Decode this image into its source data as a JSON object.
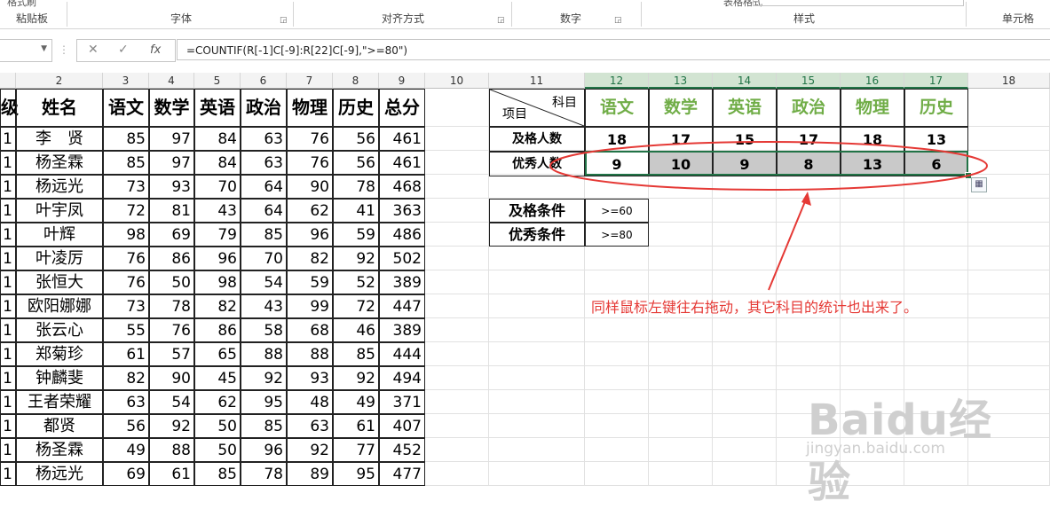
{
  "ribbon": {
    "clipboard_label": "粘贴板",
    "font_label": "字体",
    "align_label": "对齐方式",
    "number_label": "数字",
    "styles_label": "样式",
    "table_styles_label": "表格格式",
    "cells_label": "单元格",
    "format_painter_label": "格式刷"
  },
  "formula_bar": {
    "cancel": "✕",
    "enter": "✓",
    "fx": "fx",
    "formula": "=COUNTIF(R[-1]C[-9]:R[22]C[-9],\">=80\")"
  },
  "columns": [
    "",
    "2",
    "3",
    "4",
    "5",
    "6",
    "7",
    "8",
    "9",
    "10",
    "11",
    "12",
    "13",
    "14",
    "15",
    "16",
    "17",
    "18"
  ],
  "main_table": {
    "headers": [
      "级",
      "姓名",
      "语文",
      "数学",
      "英语",
      "政治",
      "物理",
      "历史",
      "总分"
    ],
    "rows": [
      [
        "1",
        "李　贤",
        "85",
        "97",
        "84",
        "63",
        "76",
        "56",
        "461"
      ],
      [
        "1",
        "杨圣霖",
        "85",
        "97",
        "84",
        "63",
        "76",
        "56",
        "461"
      ],
      [
        "1",
        "杨远光",
        "73",
        "93",
        "70",
        "64",
        "90",
        "78",
        "468"
      ],
      [
        "1",
        "叶宇凤",
        "72",
        "81",
        "43",
        "64",
        "62",
        "41",
        "363"
      ],
      [
        "1",
        "叶辉",
        "98",
        "69",
        "79",
        "85",
        "96",
        "59",
        "486"
      ],
      [
        "1",
        "叶凌厉",
        "76",
        "86",
        "96",
        "70",
        "82",
        "92",
        "502"
      ],
      [
        "1",
        "张恒大",
        "76",
        "50",
        "98",
        "54",
        "59",
        "52",
        "389"
      ],
      [
        "1",
        "欧阳娜娜",
        "73",
        "78",
        "82",
        "43",
        "99",
        "72",
        "447"
      ],
      [
        "1",
        "张云心",
        "55",
        "76",
        "86",
        "58",
        "68",
        "46",
        "389"
      ],
      [
        "1",
        "郑菊珍",
        "61",
        "57",
        "65",
        "88",
        "88",
        "85",
        "444"
      ],
      [
        "1",
        "钟麟斐",
        "82",
        "90",
        "45",
        "92",
        "93",
        "92",
        "494"
      ],
      [
        "1",
        "王者荣耀",
        "63",
        "54",
        "62",
        "95",
        "48",
        "49",
        "371"
      ],
      [
        "1",
        "都贤",
        "56",
        "92",
        "50",
        "85",
        "63",
        "61",
        "407"
      ],
      [
        "1",
        "杨圣霖",
        "49",
        "88",
        "50",
        "96",
        "92",
        "77",
        "452"
      ],
      [
        "1",
        "杨远光",
        "69",
        "61",
        "85",
        "78",
        "89",
        "95",
        "477"
      ]
    ]
  },
  "summary": {
    "corner_top": "科目",
    "corner_bottom": "项目",
    "subjects": [
      "语文",
      "数学",
      "英语",
      "政治",
      "物理",
      "历史"
    ],
    "pass_label": "及格人数",
    "pass_counts": [
      "18",
      "17",
      "15",
      "17",
      "18",
      "13"
    ],
    "excellent_label": "优秀人数",
    "excellent_counts": [
      "9",
      "10",
      "9",
      "8",
      "13",
      "6"
    ]
  },
  "conditions": {
    "pass_label": "及格条件",
    "pass_value": ">=60",
    "excellent_label": "优秀条件",
    "excellent_value": ">=80"
  },
  "annotation": "同样鼠标左键往右拖动，其它科目的统计也出来了。",
  "watermark": {
    "brand": "Baidu经验",
    "url": "jingyan.baidu.com"
  },
  "colors": {
    "accent_green": "#70ad47",
    "selection_green": "#217346",
    "annotation_red": "#e53935",
    "highlight_gray": "#c9c9c9"
  }
}
